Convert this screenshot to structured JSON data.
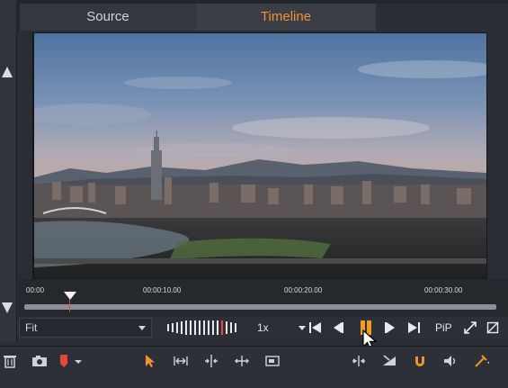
{
  "tabs": [
    {
      "label": "Source",
      "active": false
    },
    {
      "label": "Timeline",
      "active": true
    }
  ],
  "accent_color": "#f0922d",
  "timeline": {
    "timecodes": [
      "00:00",
      "00:00:10.00",
      "00:00:20.00",
      "00:00:30.00"
    ]
  },
  "controls": {
    "zoom_select": "Fit",
    "speed_select": "1x",
    "pip_label": "PiP"
  },
  "icons": {
    "transport": [
      "skip-start-icon",
      "step-back-icon",
      "pause-icon",
      "step-forward-icon",
      "skip-end-icon"
    ],
    "toolbar": [
      "trash-icon",
      "camera-icon",
      "marker-icon",
      "pointer-icon",
      "trim-icon",
      "split-icon",
      "ripple-icon",
      "rectangle-icon",
      "audio-scrub-icon",
      "slice-icon",
      "magnet-icon",
      "speaker-icon",
      "razor-icon"
    ]
  }
}
